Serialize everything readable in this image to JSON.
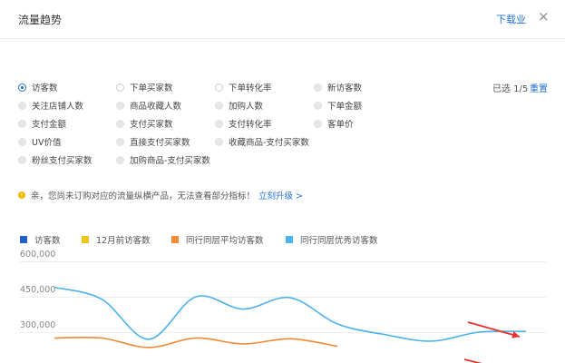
{
  "dialog": {
    "title": "流量趋势",
    "download_label": "下载业",
    "close_symbol": "×"
  },
  "metrics": {
    "rows": [
      [
        {
          "label": "访客数",
          "state": "checked"
        },
        {
          "label": "下单买家数",
          "state": "normal"
        },
        {
          "label": "下单转化率",
          "state": "normal"
        },
        {
          "label": "新访客数",
          "state": "disabled"
        }
      ],
      [
        {
          "label": "关注店铺人数",
          "state": "disabled"
        },
        {
          "label": "商品收藏人数",
          "state": "disabled"
        },
        {
          "label": "加购人数",
          "state": "disabled"
        },
        {
          "label": "下单金额",
          "state": "disabled"
        }
      ],
      [
        {
          "label": "支付金额",
          "state": "disabled"
        },
        {
          "label": "支付买家数",
          "state": "disabled"
        },
        {
          "label": "支付转化率",
          "state": "disabled"
        },
        {
          "label": "客单价",
          "state": "disabled"
        }
      ],
      [
        {
          "label": "UV价值",
          "state": "disabled"
        },
        {
          "label": "直接支付买家数",
          "state": "disabled"
        },
        {
          "label": "收藏商品-支付买家数",
          "state": "disabled"
        }
      ],
      [
        {
          "label": "粉丝支付买家数",
          "state": "disabled"
        },
        {
          "label": "加购商品-支付买家数",
          "state": "disabled"
        }
      ]
    ],
    "selected_count": "已选 1/5",
    "reset_label": "重置"
  },
  "notice": {
    "icon": "!",
    "text": "亲，您尚未订购对应的流量纵横产品，无法查看部分指标！",
    "link": "立刻升级 >"
  },
  "chart_data": {
    "type": "line",
    "legend": [
      {
        "name": "访客数",
        "color": "#1f5fc8"
      },
      {
        "name": "12月前访客数",
        "color": "#f2c31d"
      },
      {
        "name": "同行同层平均访客数",
        "color": "#f08a36"
      },
      {
        "name": "同行同层优秀访客数",
        "color": "#4db1ea"
      }
    ],
    "y_ticks": [
      "600,000",
      "450,000",
      "300,000"
    ],
    "ylim": [
      270000,
      600000
    ],
    "series": [
      {
        "name": "同行同层优秀访客数",
        "color": "#4db1ea",
        "points": [
          [
            0,
            490000
          ],
          [
            1,
            440000
          ],
          [
            2,
            270000
          ],
          [
            3,
            450000
          ],
          [
            4,
            398000
          ],
          [
            5,
            446000
          ],
          [
            6,
            335000
          ],
          [
            7,
            290000
          ],
          [
            8,
            262000
          ],
          [
            9,
            300000
          ],
          [
            10,
            303000
          ]
        ]
      },
      {
        "name": "同行同层平均访客数",
        "color": "#f08a36",
        "points": [
          [
            0,
            275000
          ],
          [
            1,
            275000
          ],
          [
            2,
            235000
          ],
          [
            3,
            275000
          ],
          [
            4,
            250000
          ],
          [
            5,
            272000
          ],
          [
            6,
            240000
          ]
        ]
      }
    ]
  },
  "colors": {
    "accent": "#1f6fd1",
    "arrow": "#e8322f"
  }
}
